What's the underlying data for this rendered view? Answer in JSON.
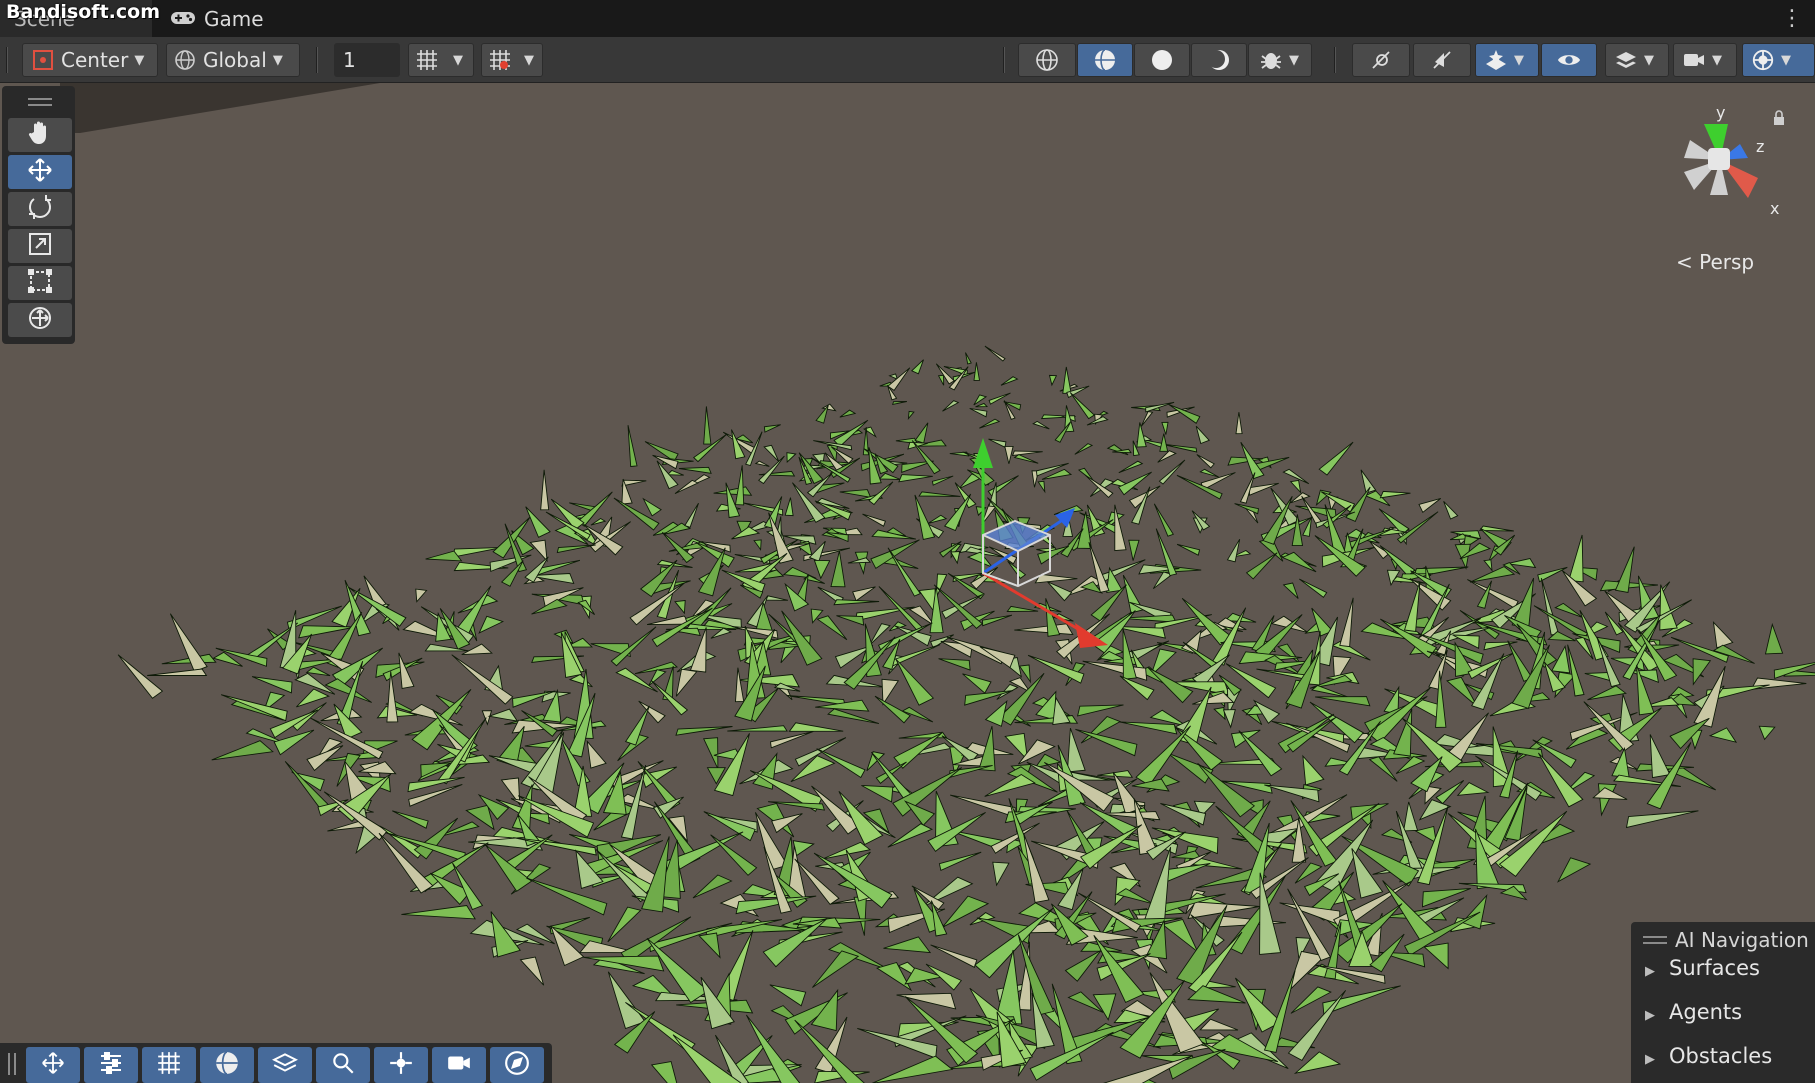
{
  "tabs": {
    "scene_label": "Scene",
    "game_label": "Game",
    "watermark": "Bandisoft.com"
  },
  "toolbar": {
    "pivot_label": "Center",
    "space_label": "Global",
    "grid_size_value": "1",
    "icons": [
      "pivot-icon",
      "global-icon",
      "grid-snap-icon",
      "grid-visibility-icon",
      "wireframe-icon",
      "shaded-icon",
      "unlit-icon",
      "lighting-icon",
      "effects-icon",
      "audio-icon",
      "fx-icon",
      "scene-visibility-icon",
      "layers-icon",
      "camera-icon",
      "gizmos-icon"
    ]
  },
  "tools": [
    "hand-tool-icon",
    "move-tool-icon",
    "rotate-tool-icon",
    "scale-tool-icon",
    "rect-tool-icon",
    "transform-tool-icon"
  ],
  "active_tool": "move-tool-icon",
  "gizmo": {
    "y_label": "y",
    "z_label": "z",
    "x_label": "x",
    "projection_label": "Persp"
  },
  "ai_navigation": {
    "title": "AI Navigation",
    "items": [
      "Surfaces",
      "Agents",
      "Obstacles"
    ]
  },
  "bottom_toolbar": {
    "icons": [
      "move-icon",
      "sliders-icon",
      "grid-icon",
      "sphere-icon",
      "layers-icon",
      "search-icon",
      "transform-icon",
      "camera-icon",
      "navigation-icon"
    ]
  },
  "colors": {
    "background": "#5f5750",
    "grass": "#7fc45a",
    "accent": "#466a9a",
    "axis_x": "#e23b2e",
    "axis_y": "#3ecf2e",
    "axis_z": "#2a63e6"
  }
}
